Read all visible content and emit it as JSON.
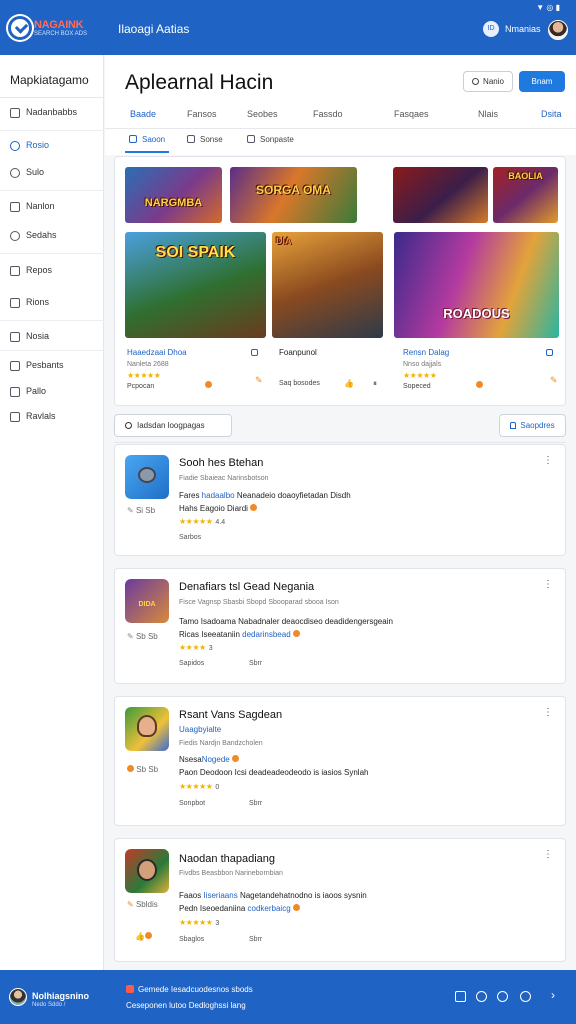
{
  "topbar": {
    "brand": "NAGAINK",
    "brand_sub": "SEARCH BOX ADS",
    "title": "Ilaoagi Aatias",
    "user_initials": "ID",
    "user_name": "Nmanias",
    "status": "▼  ◎  ▮"
  },
  "sidebar": {
    "title": "Mapkiatagamo",
    "items": [
      {
        "label": "Nadanbabbs",
        "icon": "home-icon"
      },
      {
        "label": "Rosio",
        "icon": "person-icon"
      },
      {
        "label": "Sulo",
        "icon": "search-icon"
      },
      {
        "label": "Nanlon",
        "icon": "folder-icon"
      },
      {
        "label": "Sedahs",
        "icon": "gear-icon"
      },
      {
        "label": "Repos",
        "icon": "list-icon"
      },
      {
        "label": "Rions",
        "icon": "chat-icon"
      },
      {
        "label": "Nosia",
        "icon": "tag-icon"
      },
      {
        "label": "Pesbants",
        "icon": "doc-icon"
      },
      {
        "label": "Pallo",
        "icon": "clip-icon"
      },
      {
        "label": "Ravlals",
        "icon": "calendar-icon"
      }
    ]
  },
  "header": {
    "title": "Aplearnal Hacin",
    "outline_btn": "Nanio",
    "primary_btn": "Bnam",
    "tabs": [
      "Baade",
      "Fansos",
      "Seobes",
      "Fassdo",
      "Fasqaes",
      "Nlais",
      "Dsita"
    ],
    "subtabs": [
      "Saoon",
      "Sonse",
      "Sonpaste"
    ]
  },
  "featured": {
    "top_art": [
      "NARGMBA",
      "SORGA OMA",
      "",
      "BAOLIA"
    ],
    "cards": [
      {
        "art": "SOI SPAIK",
        "name": "Haaedzaai Dhoa",
        "sub": "Nanleta 2688",
        "stars": "★★★★★",
        "foot": "Pcpocan"
      },
      {
        "art": "DIA",
        "name": "Foanpunol",
        "sub": "",
        "stars": "",
        "foot": "Saq bosodes"
      },
      {
        "art": "ROADOUS",
        "name": "Rensn Dalag",
        "sub": "Nnso dajjals",
        "stars": "★★★★★",
        "foot": "Sopeced"
      }
    ]
  },
  "search": {
    "label": "Iadsdan loogpagas"
  },
  "sort": {
    "label": "Saopdres"
  },
  "list": [
    {
      "title": "Sooh hes Btehan",
      "sub": "Fiadie Sbaieac  Narinsbotson",
      "line1_a": "Fares ",
      "line1_hl": "hadaalbo",
      "line1_b": " Neanadeio doaoyfietadan Disdh",
      "line2": "Hahs  Eagoio Diardi",
      "stars": "★★★★★",
      "rating": "4.4",
      "left": "Si Sb",
      "foot": "Sarbos",
      "foot2": ""
    },
    {
      "title": "Denafiars tsl Gead Negania",
      "sub": "Fisce Vagnsp  Sbasbi Sbopd  Sbooparad sbooa Ison",
      "line1_a": "Tamo  Isadoama  Nabadnaler deaocdiseo  deadidengersgeain",
      "line1_hl": "",
      "line1_b": "",
      "line2_a": "Ricas  Iseeataniin  ",
      "line2_hl": "dedarinsbead",
      "stars": "★★★★",
      "rating": "3",
      "left": "Sb Sb",
      "foot": "Sapidos",
      "foot2": "Sbrr"
    },
    {
      "title": "Rsant Vans Sagdean",
      "title_hl": "Uaagbyialte",
      "sub": "Fiedis  Nardjn  Bandzcholen",
      "line1_a": "Nsesa",
      "line1_hl": "Nogede",
      "line2": "Paon  Deodoon  Icsi  deadeadeodeodo  is  iasios  Synlah",
      "stars": "★★★★★",
      "rating": "0",
      "left": "Sb Sb",
      "foot": "Sonpbot",
      "foot2": "Sbrr"
    },
    {
      "title": "Naodan thapadiang",
      "sub": "Fivdbs  Beasbbon  Narinebornbian",
      "line1_a": "Faaos  ",
      "line1_hl": "Iiseriaans",
      "line1_b": "  Nagetandehatnodno  is  iaoos  sysnin",
      "line2_a": "Pedn  Iseoedaniina  ",
      "line2_hl": "codkerbaicg",
      "stars": "★★★★★",
      "rating": "3",
      "left": "Sbldis",
      "foot": "Sbaglos",
      "foot2": "Sbrr"
    }
  ],
  "footer": {
    "name": "Nolhiagsnino",
    "sub": "Nedo Sddo  /",
    "line1": "Gemede  Iesadcuodesnos sbods",
    "line2": "Ceseponen lutoo  Dedloghssi lang"
  },
  "colors": {
    "brand": "#1f63c4",
    "accent": "#1f7ae0",
    "star": "#f2b400"
  }
}
